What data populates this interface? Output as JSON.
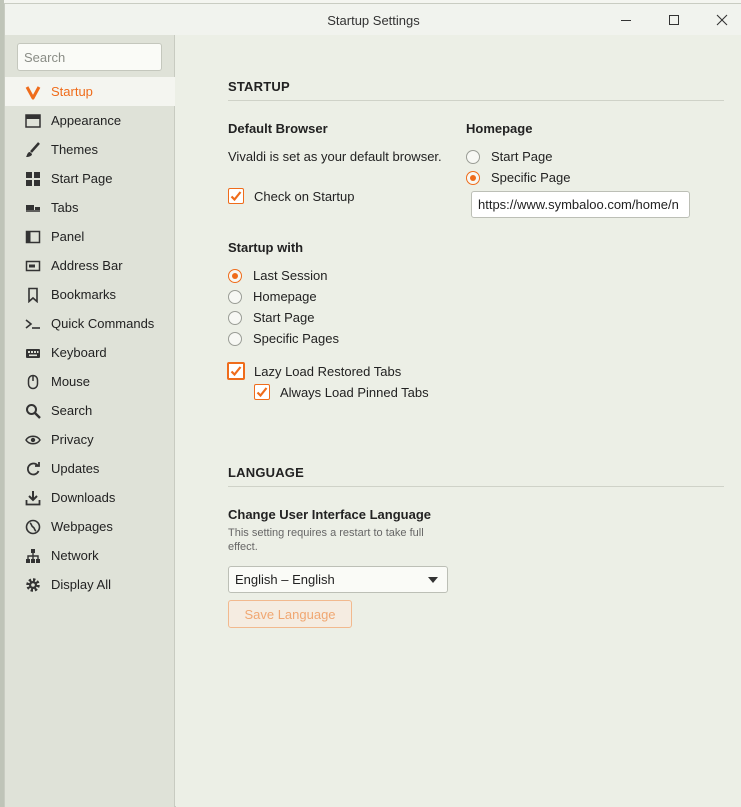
{
  "window": {
    "title": "Startup Settings"
  },
  "search": {
    "placeholder": "Search"
  },
  "sidebar": {
    "items": [
      {
        "label": "Startup",
        "icon": "vivaldi-logo-icon",
        "active": true
      },
      {
        "label": "Appearance",
        "icon": "appearance-icon"
      },
      {
        "label": "Themes",
        "icon": "brush-icon"
      },
      {
        "label": "Start Page",
        "icon": "grid-icon"
      },
      {
        "label": "Tabs",
        "icon": "tabs-icon"
      },
      {
        "label": "Panel",
        "icon": "panel-icon"
      },
      {
        "label": "Address Bar",
        "icon": "address-bar-icon"
      },
      {
        "label": "Bookmarks",
        "icon": "bookmark-icon"
      },
      {
        "label": "Quick Commands",
        "icon": "quick-commands-icon"
      },
      {
        "label": "Keyboard",
        "icon": "keyboard-icon"
      },
      {
        "label": "Mouse",
        "icon": "mouse-icon"
      },
      {
        "label": "Search",
        "icon": "search-icon"
      },
      {
        "label": "Privacy",
        "icon": "eye-icon"
      },
      {
        "label": "Updates",
        "icon": "refresh-icon"
      },
      {
        "label": "Downloads",
        "icon": "download-icon"
      },
      {
        "label": "Webpages",
        "icon": "globe-icon"
      },
      {
        "label": "Network",
        "icon": "network-icon"
      },
      {
        "label": "Display All",
        "icon": "gear-icon"
      }
    ]
  },
  "startup": {
    "heading": "STARTUP",
    "default_browser_label": "Default Browser",
    "default_browser_status": "Vivaldi is set as your default browser.",
    "check_on_startup": "Check on Startup",
    "homepage_label": "Homepage",
    "homepage_options": [
      "Start Page",
      "Specific Page"
    ],
    "homepage_selected": "Specific Page",
    "homepage_url": "https://www.symbaloo.com/home/n",
    "startup_with_label": "Startup with",
    "startup_with_options": [
      "Last Session",
      "Homepage",
      "Start Page",
      "Specific Pages"
    ],
    "startup_with_selected": "Last Session",
    "lazy_load": "Lazy Load Restored Tabs",
    "always_load_pinned": "Always Load Pinned Tabs"
  },
  "language": {
    "heading": "LANGUAGE",
    "label": "Change User Interface Language",
    "note": "This setting requires a restart to take full effect.",
    "selected": "English – English",
    "save_button": "Save Language"
  },
  "colors": {
    "accent": "#ef6c1b",
    "sidebar_bg": "#dfe2d8",
    "content_bg": "#ecefe6"
  }
}
